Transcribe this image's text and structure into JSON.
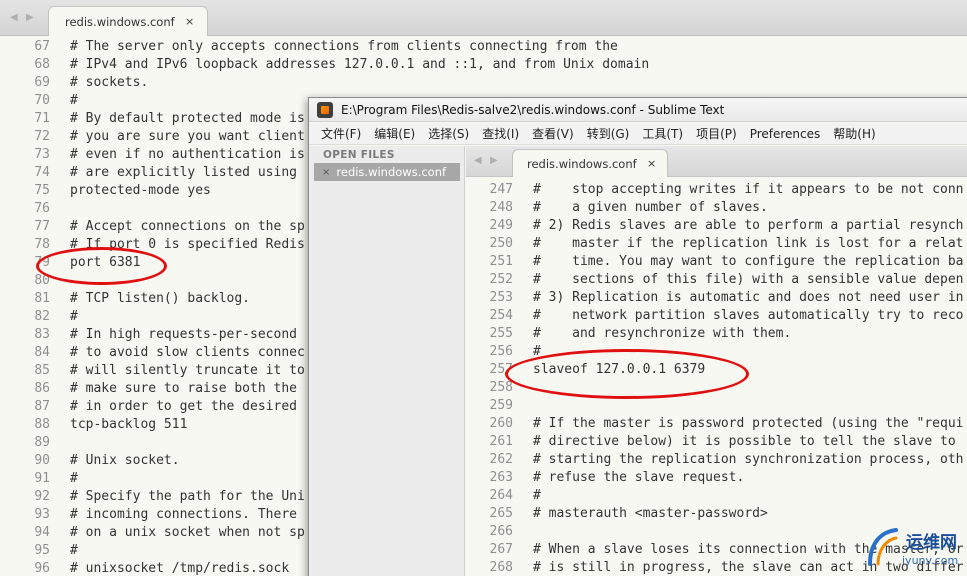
{
  "back_editor": {
    "tab_label": "redis.windows.conf",
    "tab_close": "×",
    "tab_nav_left": "◀",
    "tab_nav_right": "▶",
    "line_numbers": [
      "67",
      "68",
      "69",
      "70",
      "71",
      "72",
      "73",
      "74",
      "75",
      "76",
      "77",
      "78",
      "79",
      "80",
      "81",
      "82",
      "83",
      "84",
      "85",
      "86",
      "87",
      "88",
      "89",
      "90",
      "91",
      "92",
      "93",
      "94",
      "95",
      "96"
    ],
    "lines": [
      "# The server only accepts connections from clients connecting from the",
      "# IPv4 and IPv6 loopback addresses 127.0.0.1 and ::1, and from Unix domain",
      "# sockets.",
      "#",
      "# By default protected mode is",
      "# you are sure you want client",
      "# even if no authentication is",
      "# are explicitly listed using",
      "protected-mode yes",
      "",
      "# Accept connections on the sp",
      "# If port 0 is specified Redis",
      "port 6381",
      "",
      "# TCP listen() backlog.",
      "#",
      "# In high requests-per-second",
      "# to avoid slow clients connec",
      "# will silently truncate it to",
      "# make sure to raise both the",
      "# in order to get the desired",
      "tcp-backlog 511",
      "",
      "# Unix socket.",
      "#",
      "# Specify the path for the Uni",
      "# incoming connections. There",
      "# on a unix socket when not sp",
      "#",
      "# unixsocket /tmp/redis.sock"
    ]
  },
  "front_window": {
    "title": "E:\\Program Files\\Redis-salve2\\redis.windows.conf - Sublime Text",
    "menu": [
      "文件(F)",
      "编辑(E)",
      "选择(S)",
      "查找(I)",
      "查看(V)",
      "转到(G)",
      "工具(T)",
      "项目(P)",
      "Preferences",
      "帮助(H)"
    ],
    "sidebar": {
      "heading": "OPEN FILES",
      "file_label": "redis.windows.conf",
      "file_close": "×"
    },
    "tab_label": "redis.windows.conf",
    "tab_close": "×",
    "tab_nav_left": "◀",
    "tab_nav_right": "▶",
    "line_numbers": [
      "247",
      "248",
      "249",
      "250",
      "251",
      "252",
      "253",
      "254",
      "255",
      "256",
      "257",
      "258",
      "259",
      "260",
      "261",
      "262",
      "263",
      "264",
      "265",
      "266",
      "267",
      "268"
    ],
    "lines": [
      "#    stop accepting writes if it appears to be not conn",
      "#    a given number of slaves.",
      "# 2) Redis slaves are able to perform a partial resynch",
      "#    master if the replication link is lost for a relat",
      "#    time. You may want to configure the replication ba",
      "#    sections of this file) with a sensible value depen",
      "# 3) Replication is automatic and does not need user in",
      "#    network partition slaves automatically try to reco",
      "#    and resynchronize with them.",
      "#",
      "slaveof 127.0.0.1 6379",
      "",
      "",
      "# If the master is password protected (using the \"requi",
      "# directive below) it is possible to tell the slave to",
      "# starting the replication synchronization process, oth",
      "# refuse the slave request.",
      "#",
      "# masterauth <master-password>",
      "",
      "# When a slave loses its connection with the master, or",
      "# is still in progress, the slave can act in two differ"
    ]
  },
  "watermark": {
    "cn_text": "运维网",
    "url_text": "iyunv.com"
  },
  "colors": {
    "annotation_red": "#e11010",
    "editor_bg": "#f8f8f3",
    "gutter_fg": "#8f8f8f"
  }
}
